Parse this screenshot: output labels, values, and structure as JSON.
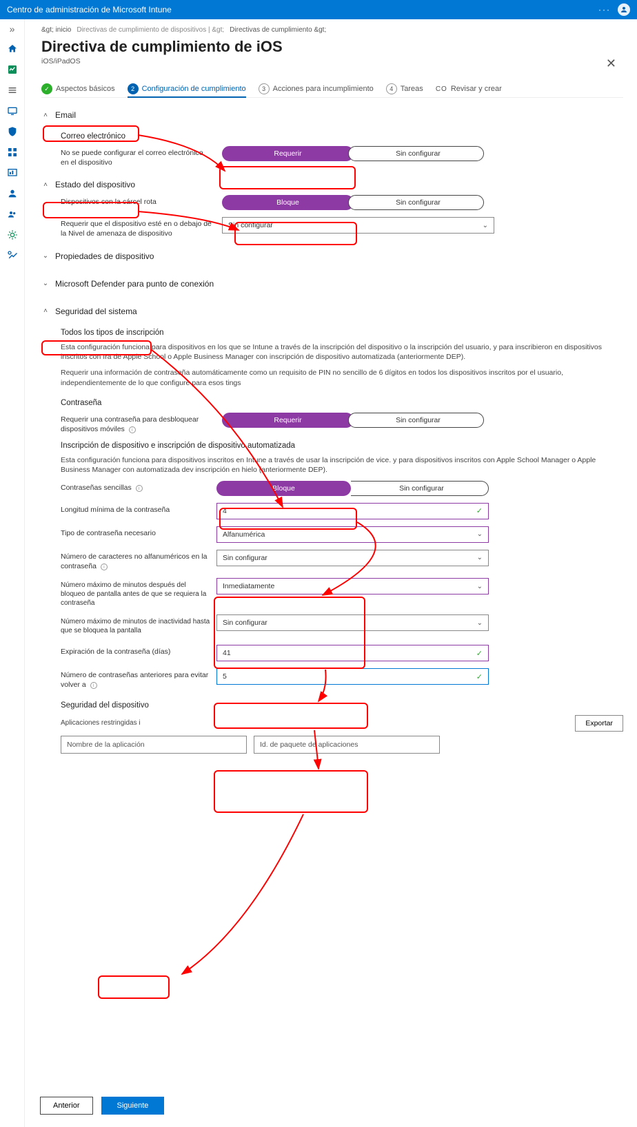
{
  "topbar": {
    "title": "Centro de administración de Microsoft Intune"
  },
  "breadcrumb": {
    "home": "&gt; inicio",
    "mid": "Directivas de cumplimiento de dispositivos | &gt;",
    "last": "Directivas de cumplimiento &gt;"
  },
  "page": {
    "title": "Directiva de cumplimiento de iOS",
    "subtitle": "iOS/iPadOS"
  },
  "steps": {
    "s1": "Aspectos básicos",
    "s2": "Configuración de cumplimiento",
    "s3": "Acciones para incumplimiento",
    "s4": "Tareas",
    "s4num": "4",
    "s5pre": "CO",
    "s5": "Revisar y crear"
  },
  "common": {
    "not_configured": "Sin configurar",
    "require": "Requerir",
    "block": "Bloque",
    "export": "Exportar",
    "previous": "Anterior",
    "next": "Siguiente"
  },
  "email": {
    "header": "Email",
    "sub": "Correo electrónico",
    "row1_label": "No se puede configurar el correo electrónico en el dispositivo"
  },
  "dhealth": {
    "header": "Estado del dispositivo",
    "row1_label": "Dispositivos con la cárcel rota",
    "row2_label": "Requerir que el dispositivo esté en o debajo de la Nivel de amenaza de dispositivo"
  },
  "dprops": {
    "header": "Propiedades de dispositivo"
  },
  "defender": {
    "header": "Microsoft Defender para punto de conexión"
  },
  "syssec": {
    "header": "Seguridad del sistema",
    "all_enroll": "Todos los tipos de inscripción",
    "desc1": "Esta configuración funciona para dispositivos en los que se Intune a través de la inscripción del dispositivo o la inscripción del usuario, y para inscribieron en dispositivos inscritos con Ira de Apple School o Apple Business Manager con inscripción de dispositivo automatizada (anteriormente DEP).",
    "desc2": "Requerir una información de contraseña automáticamente como un requisito de PIN no sencillo de 6 dígitos en todos los dispositivos inscritos por el usuario, independientemente de lo que configure para esos tings",
    "pw_head": "Contraseña",
    "pw_req_label": "Requerir una contraseña para desbloquear dispositivos móviles",
    "enroll_head": "Inscripción de dispositivo e inscripción de dispositivo automatizada",
    "desc3": "Esta configuración funciona para dispositivos inscritos en Intune a través de usar la inscripción de vice. y para dispositivos inscritos con Apple School Manager o Apple Business Manager con automatizada dev inscripción en hielo (anteriormente DEP).",
    "simple_label": "Contraseñas sencillas",
    "minlen_label": "Longitud mínima de la contraseña",
    "minlen_value": "4",
    "pwtype_label": "Tipo de contraseña necesario",
    "pwtype_value": "Alfanumérica",
    "nonalpha_label": "Número de caracteres no alfanuméricos en la contraseña",
    "maxmin_lock_label": "Número máximo de minutos después del bloqueo de pantalla antes de que se requiera la contraseña",
    "maxmin_lock_value": "Inmediatamente",
    "maxmin_inact_label": "Número máximo de minutos de inactividad hasta que se bloquea la pantalla",
    "expire_label": "Expiración de la contraseña (días)",
    "expire_value": "41",
    "prev_label": "Número de contraseñas anteriores para evitar volver a",
    "prev_value": "5",
    "devsec": "Seguridad del dispositivo",
    "restr_apps": "Aplicaciones restringidas",
    "appname_ph": "Nombre de la aplicación",
    "bundle_ph": "Id. de paquete de aplicaciones"
  }
}
